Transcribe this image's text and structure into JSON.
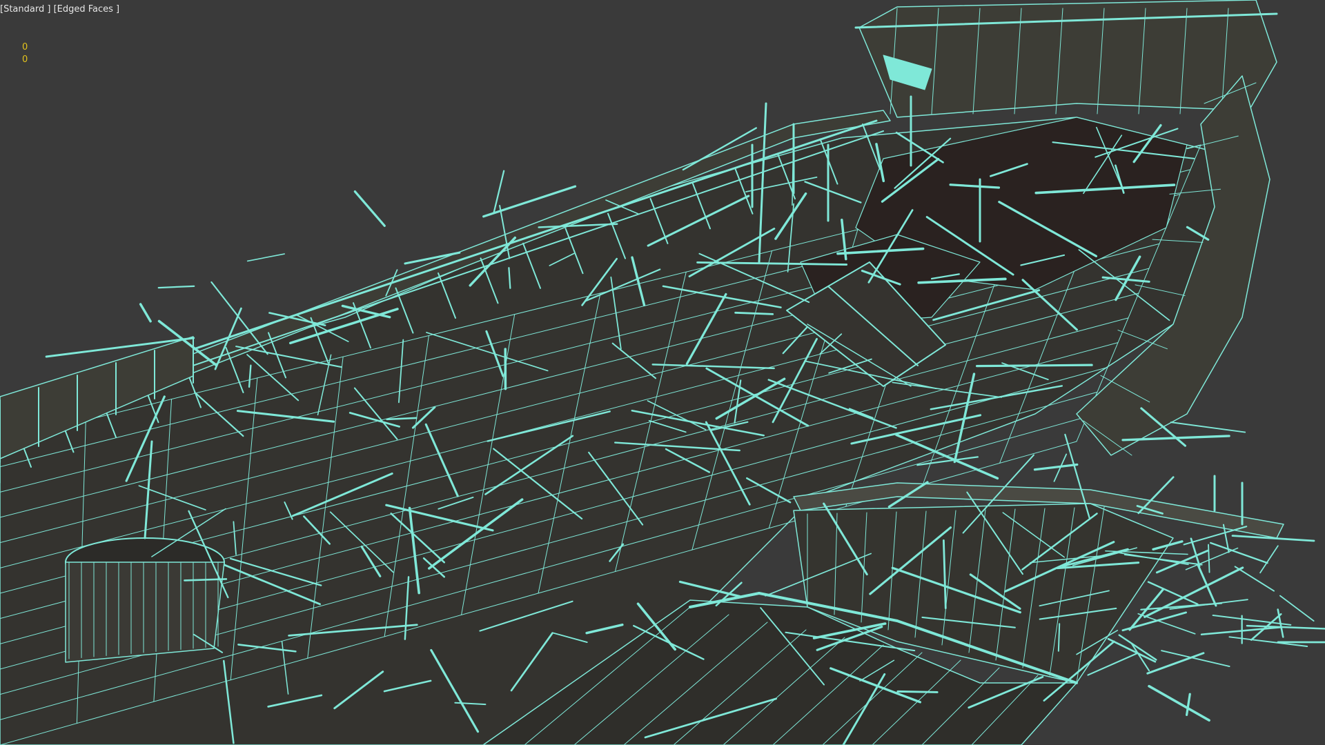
{
  "viewport": {
    "labels": [
      "[Standard ]",
      "[Edged Faces ]"
    ],
    "stats": [
      "0",
      "0"
    ],
    "background": "#3a3a3a",
    "wire_color": "#7fe8d8",
    "hull_color": "#3d3d36",
    "interior_color": "#2a2220"
  }
}
